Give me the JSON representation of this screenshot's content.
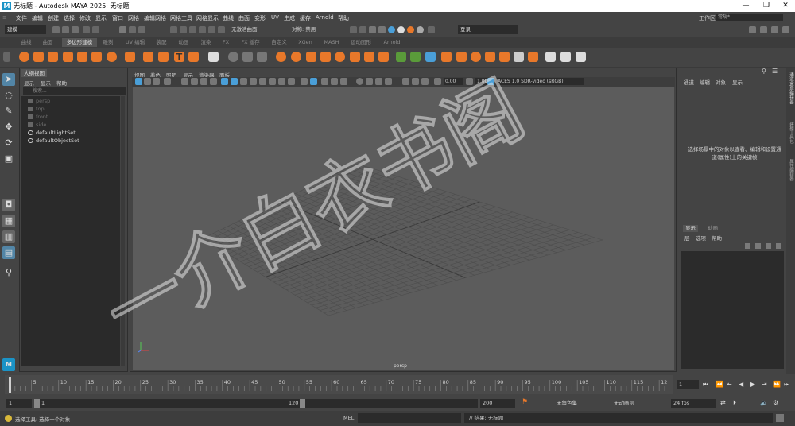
{
  "window": {
    "app_icon": "M",
    "title": "无标题 - Autodesk MAYA 2025: 无标题",
    "controls": [
      "—",
      "❐",
      "✕"
    ]
  },
  "menubar": {
    "items": [
      "文件",
      "编辑",
      "创建",
      "选择",
      "修改",
      "显示",
      "窗口",
      "网格",
      "编辑网格",
      "网格工具",
      "网格显示",
      "曲线",
      "曲面",
      "变形",
      "UV",
      "生成",
      "缓存",
      "Arnold",
      "帮助"
    ],
    "workspace_label": "工作区:",
    "workspace_value": "常规*"
  },
  "statusline": {
    "menu_set": "建模",
    "live_surface": "无激活曲面",
    "symmetry": "对称: 禁用",
    "login": "登录"
  },
  "shelf": {
    "tabs": [
      "曲线",
      "曲面",
      "多边形建模",
      "雕刻",
      "UV 编辑",
      "装配",
      "动画",
      "渲染",
      "FX",
      "FX 缓存",
      "自定义",
      "XGen",
      "MASH",
      "运动图形",
      "Arnold"
    ],
    "active_tab": "多边形建模"
  },
  "outliner": {
    "tab": "大纲视图",
    "menu": [
      "显示",
      "显示",
      "帮助"
    ],
    "search_placeholder": "搜索...",
    "items": [
      {
        "label": "persp",
        "kind": "camera"
      },
      {
        "label": "top",
        "kind": "camera"
      },
      {
        "label": "front",
        "kind": "camera"
      },
      {
        "label": "side",
        "kind": "camera"
      },
      {
        "label": "defaultLightSet",
        "kind": "set"
      },
      {
        "label": "defaultObjectSet",
        "kind": "set"
      }
    ]
  },
  "viewport": {
    "menu": [
      "视图",
      "着色",
      "照明",
      "显示",
      "渲染器",
      "面板"
    ],
    "near_value": "0.00",
    "far_value": "1.00",
    "color_management": "ACES 1.0 SDR-video (sRGB)",
    "camera_label": "persp"
  },
  "channelbox": {
    "menu": [
      "通道",
      "编辑",
      "对象",
      "显示"
    ],
    "message": "选择场景中的对象以查看、编辑和设置通道(属性)上的关键帧"
  },
  "layers": {
    "tabs": [
      "显示",
      "动画"
    ],
    "menu": [
      "层",
      "选项",
      "帮助"
    ]
  },
  "right_tabs": [
    "通道盒/层编辑器",
    "建模工具包",
    "属性编辑器"
  ],
  "timeslider": {
    "ticks": [
      "5",
      "10",
      "15",
      "20",
      "25",
      "30",
      "35",
      "40",
      "45",
      "50",
      "55",
      "60",
      "65",
      "70",
      "75",
      "80",
      "85",
      "90",
      "95",
      "100",
      "105",
      "110",
      "115",
      "12"
    ],
    "current_frame": "1"
  },
  "range": {
    "start": "1",
    "inner_start": "1",
    "inner_end": "120",
    "end_inner": "120",
    "end": "200",
    "character_set": "无角色集",
    "anim_layer": "无动画层",
    "fps": "24 fps"
  },
  "commandline": {
    "help_text": "选择工具: 选择一个对象",
    "mel_label": "MEL",
    "result": "// 结果: 无标题"
  },
  "watermark": {
    "text": "一介白衣书阁"
  },
  "colors": {
    "accent_blue": "#4a9fd8",
    "shelf_orange": "#e8782a",
    "viewport_bg": "#5c5c5c",
    "grid": "#4d4d4d"
  }
}
